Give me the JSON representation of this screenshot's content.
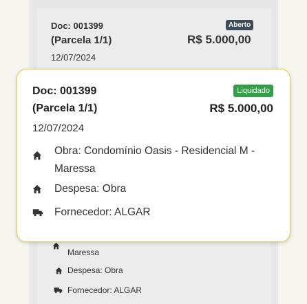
{
  "background_card": {
    "doc": "Doc: 001399",
    "parcela": "(Parcela 1/1)",
    "date": "12/07/2024",
    "status": "Aberto",
    "amount": "R$ 5.000,00",
    "obra_tail": "Maressa",
    "despesa": "Despesa: Obra",
    "fornecedor": "Fornecedor: ALGAR"
  },
  "card": {
    "doc": "Doc: 001399",
    "parcela": "(Parcela 1/1)",
    "date": "12/07/2024",
    "status": "Liquidado",
    "amount": "R$ 5.000,00",
    "obra": "Obra: Condomínio Oasis - Residencial M - Maressa",
    "despesa": "Despesa: Obra",
    "fornecedor": "Fornecedor: ALGAR"
  },
  "icons": {
    "obra": "home-icon",
    "despesa": "home-icon",
    "fornecedor": "truck-icon"
  },
  "colors": {
    "liquidado_badge": "#2f9e44",
    "aberto_badge": "#3e4a55",
    "highlight_border": "#e7c94a"
  }
}
